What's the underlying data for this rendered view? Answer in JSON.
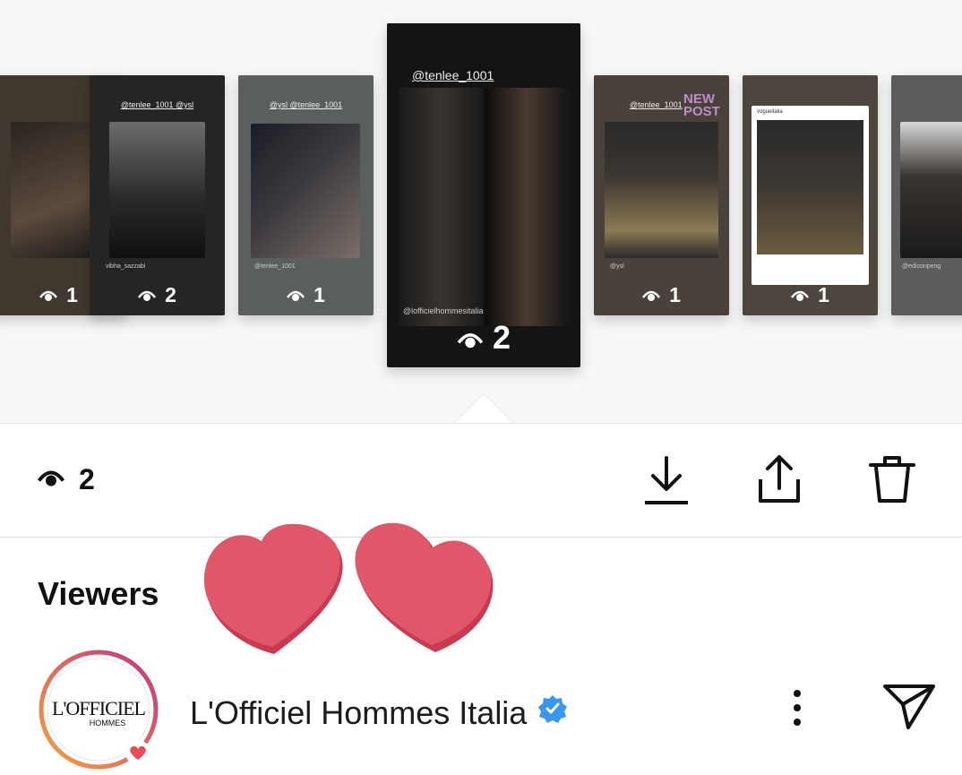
{
  "stories": [
    {
      "id": "s1",
      "count": "1",
      "caption": ""
    },
    {
      "id": "s2",
      "count": "2",
      "caption": "@tenlee_1001 @ysl",
      "tinycap": "vibha_sazzabi"
    },
    {
      "id": "s3",
      "count": "1",
      "caption": "@ysl @tenlee_1001",
      "tinycap": "@tenlee_1001"
    },
    {
      "id": "s4",
      "count": "2",
      "caption": "@tenlee_1001",
      "tinycap": "@lofficielhommesitalia",
      "active": true
    },
    {
      "id": "s5",
      "count": "1",
      "caption": "@tenlee_1001",
      "badge": "NEW POST",
      "tinycap": "@ysl"
    },
    {
      "id": "s6",
      "count": "1",
      "caption": "",
      "tinycap": "vogueitalia"
    },
    {
      "id": "s7",
      "count": "",
      "caption": "",
      "tinycap": "@edisonpeng"
    }
  ],
  "actionbar": {
    "view_count": "2"
  },
  "viewers": {
    "title": "Viewers",
    "items": [
      {
        "name": "L'Officiel Hommes Italia",
        "verified": true,
        "avatar_text": "L'OFFICIEL",
        "avatar_sub": "HOMMES"
      }
    ]
  },
  "colors": {
    "heart": "#e0576a",
    "verified": "#3897f0",
    "avatar_ring_start": "#f9a03c",
    "avatar_ring_end": "#c13584"
  },
  "icons": [
    "eye-icon",
    "download-icon",
    "share-icon",
    "trash-icon",
    "more-vertical-icon",
    "send-icon",
    "verified-badge-icon",
    "heart-sticker"
  ]
}
